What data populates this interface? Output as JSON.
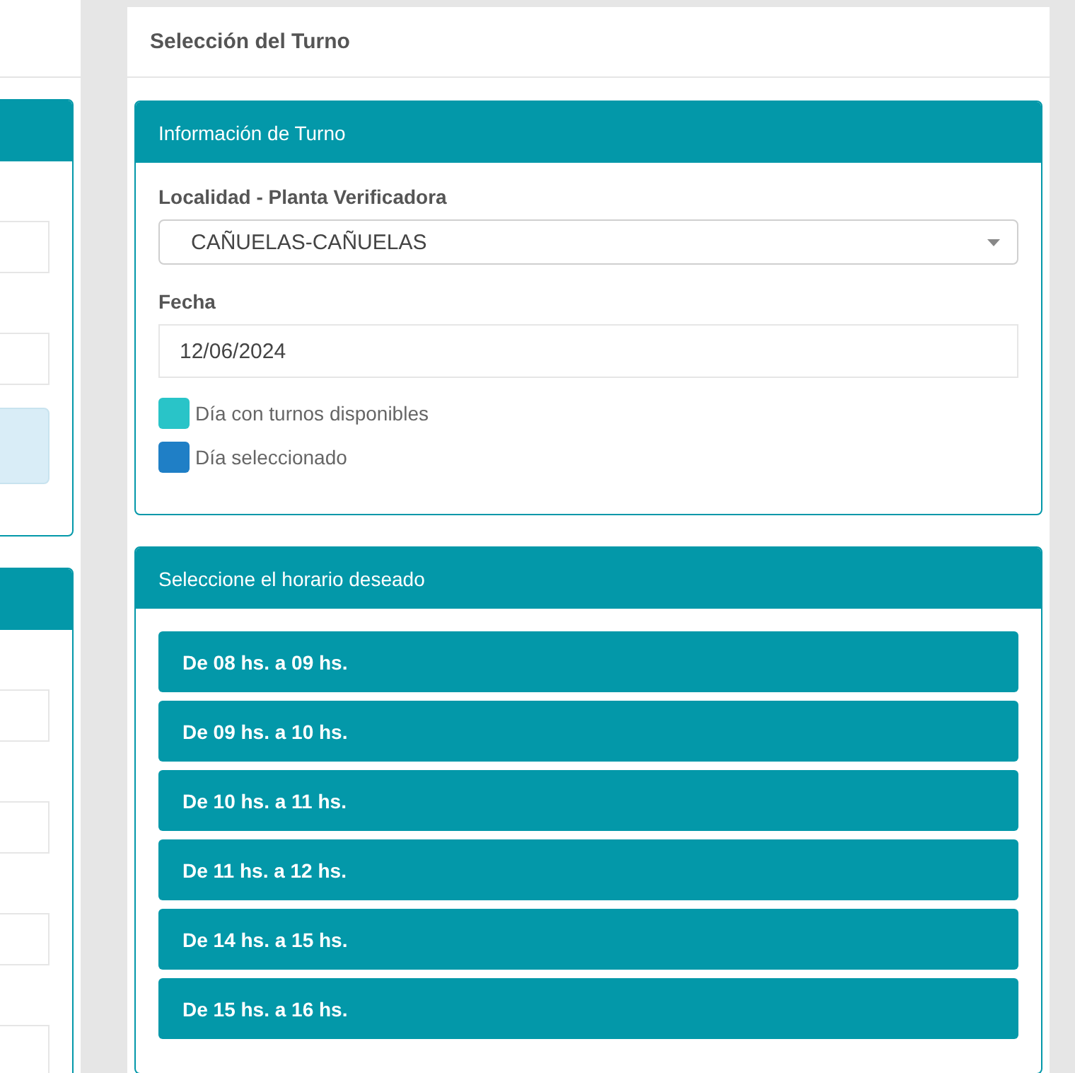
{
  "side_column": {
    "panels": [
      {
        "fields": [
          {
            "kind": "input"
          },
          {
            "kind": "input"
          },
          {
            "kind": "note"
          }
        ]
      },
      {
        "fields": [
          {
            "kind": "input"
          },
          {
            "kind": "input"
          },
          {
            "kind": "input"
          },
          {
            "kind": "input"
          }
        ]
      }
    ]
  },
  "card": {
    "title": "Selección del Turno"
  },
  "info_panel": {
    "title": "Información de Turno",
    "location": {
      "label": "Localidad - Planta Verificadora",
      "value": "CAÑUELAS-CAÑUELAS"
    },
    "date": {
      "label": "Fecha",
      "value": "12/06/2024"
    },
    "legend": [
      {
        "label": "Día con turnos disponibles",
        "color": "#29c4c8"
      },
      {
        "label": "Día seleccionado",
        "color": "#1f7fc6"
      }
    ]
  },
  "schedule_panel": {
    "title": "Seleccione el horario deseado",
    "slots": [
      {
        "label": "De 08 hs. a 09 hs."
      },
      {
        "label": "De 09 hs. a 10 hs."
      },
      {
        "label": "De 10 hs. a 11 hs."
      },
      {
        "label": "De 11 hs. a 12 hs."
      },
      {
        "label": "De 14 hs. a 15 hs."
      },
      {
        "label": "De 15 hs. a 16 hs."
      }
    ]
  }
}
